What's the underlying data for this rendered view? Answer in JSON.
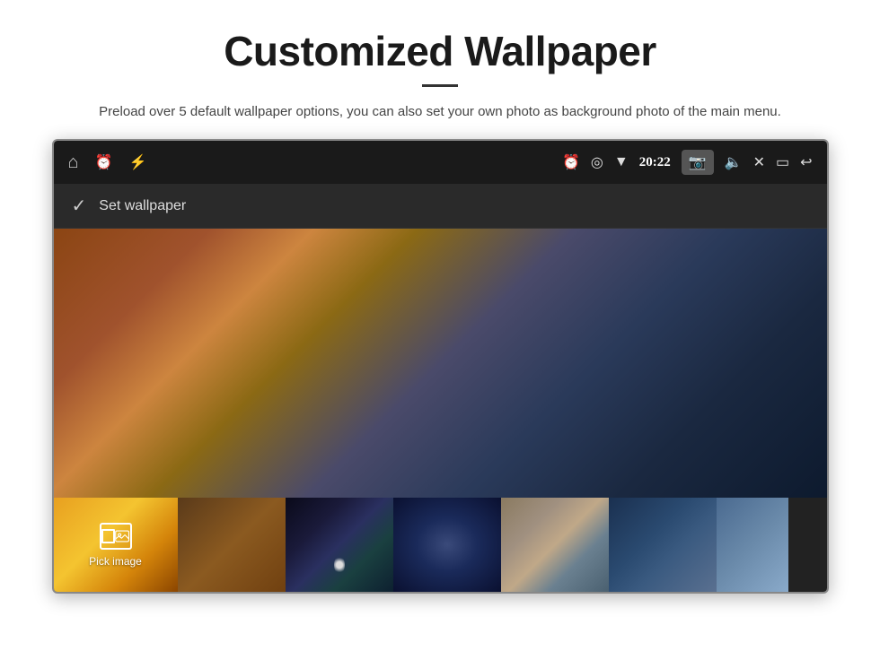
{
  "page": {
    "title": "Customized Wallpaper",
    "subtitle": "Preload over 5 default wallpaper options, you can also set your own photo as background photo of the main menu."
  },
  "status_bar": {
    "time": "20:22",
    "left_icons": [
      "home",
      "alarm",
      "usb"
    ],
    "right_icons": [
      "alarm",
      "location",
      "wifi",
      "camera",
      "volume",
      "close",
      "window",
      "back"
    ]
  },
  "wallpaper_ui": {
    "set_wallpaper_label": "Set wallpaper",
    "pick_image_label": "Pick image"
  }
}
